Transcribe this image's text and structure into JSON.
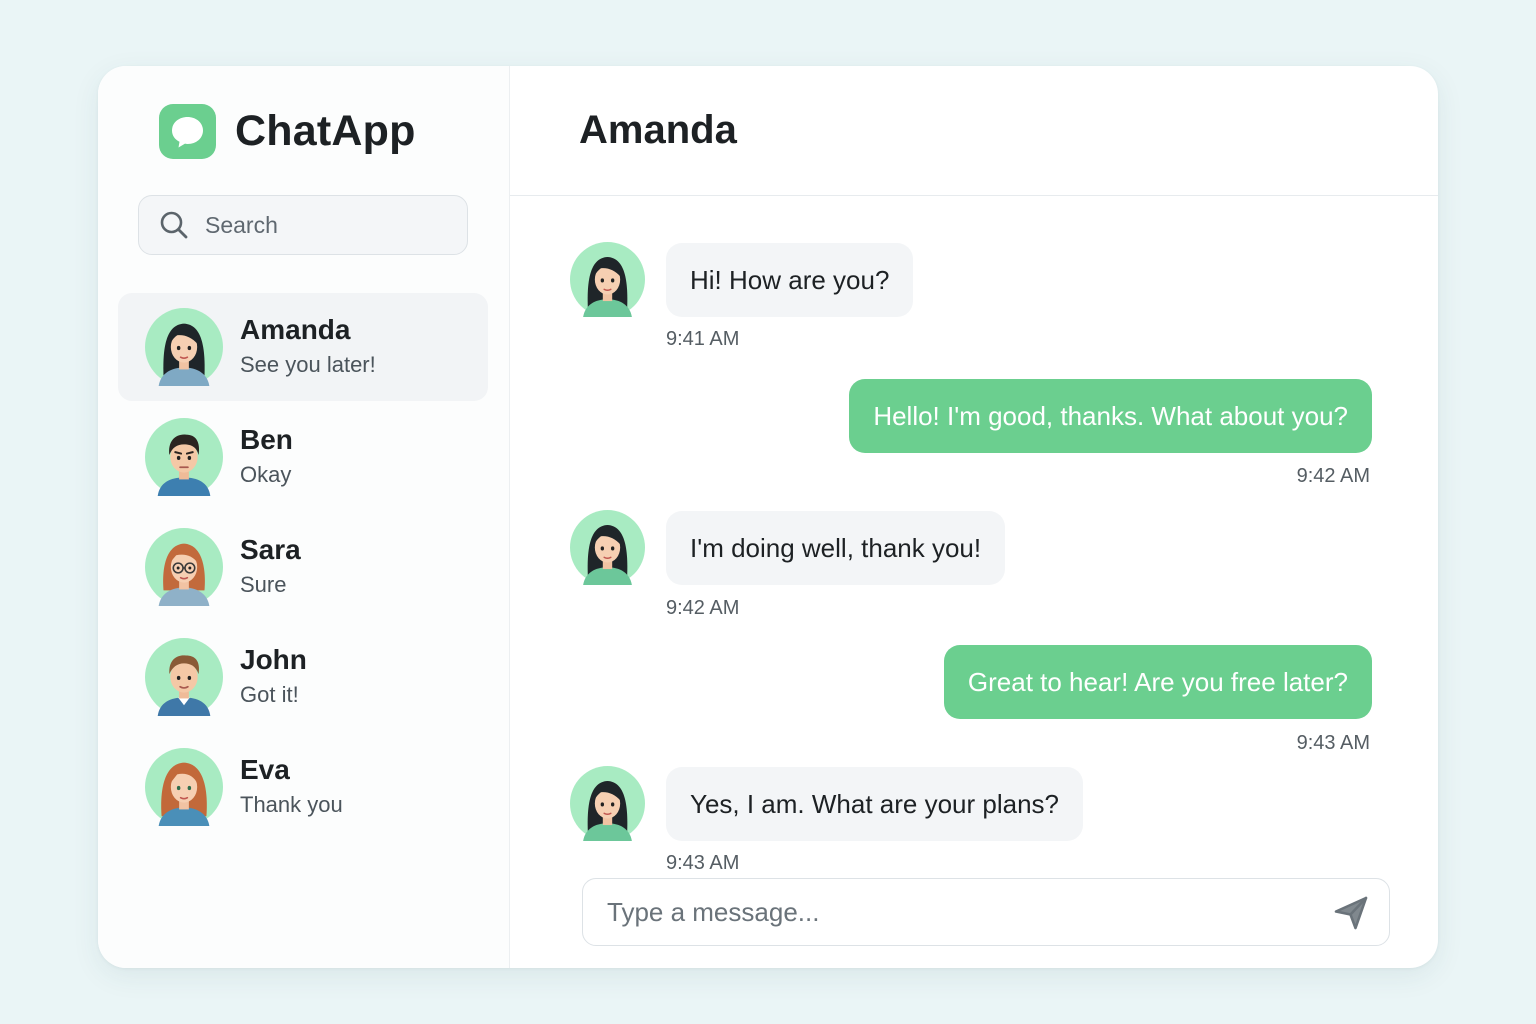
{
  "app": {
    "name": "ChatApp",
    "logo_icon": "chat-bubble-icon",
    "accent_color": "#6bcf8f"
  },
  "search": {
    "placeholder": "Search",
    "icon": "search-icon"
  },
  "contacts": [
    {
      "name": "Amanda",
      "preview": "See you later!",
      "active": true
    },
    {
      "name": "Ben",
      "preview": "Okay",
      "active": false
    },
    {
      "name": "Sara",
      "preview": "Sure",
      "active": false
    },
    {
      "name": "John",
      "preview": "Got it!",
      "active": false
    },
    {
      "name": "Eva",
      "preview": "Thank you",
      "active": false
    }
  ],
  "chat": {
    "title": "Amanda",
    "messages": [
      {
        "direction": "in",
        "text": "Hi! How are you?",
        "time": "9:41 AM"
      },
      {
        "direction": "out",
        "text": "Hello! I'm good, thanks. What about you?",
        "time": "9:42 AM"
      },
      {
        "direction": "in",
        "text": "I'm doing well, thank you!",
        "time": "9:42 AM"
      },
      {
        "direction": "out",
        "text": "Great to hear! Are you free later?",
        "time": "9:43 AM"
      },
      {
        "direction": "in",
        "text": "Yes, I am. What are your plans?",
        "time": "9:43 AM"
      }
    ]
  },
  "composer": {
    "placeholder": "Type a message...",
    "send_icon": "send-icon"
  },
  "colors": {
    "page_background": "#eaf5f6",
    "outgoing_bubble": "#6bcf8f",
    "incoming_bubble": "#f3f5f7",
    "avatar_background": "#a8ebc2"
  }
}
